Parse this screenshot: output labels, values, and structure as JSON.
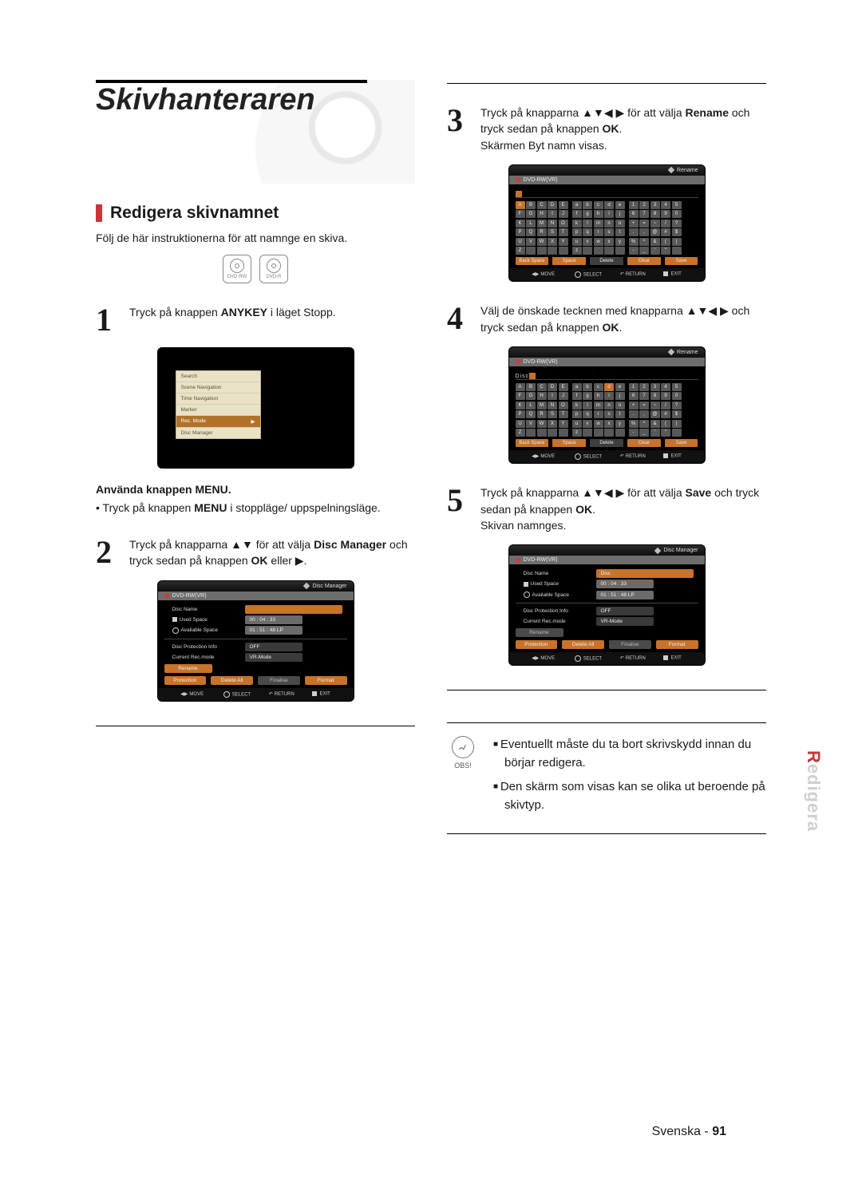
{
  "chapter_title": "Skivhanteraren",
  "section_title": "Redigera skivnamnet",
  "intro": "Följ de här instruktionerna för att namnge en skiva.",
  "badges": [
    "DVD-RW",
    "DVD-R"
  ],
  "side_tab_highlight": "R",
  "side_tab_rest": "edigera",
  "steps": {
    "s1": {
      "n": "1",
      "text_a": "Tryck på knappen ",
      "bold_a": "ANYKEY",
      "text_b": " i läget Stopp."
    },
    "s2": {
      "n": "2",
      "text_a": "Tryck på knapparna ",
      "arrows": "▲▼",
      "text_b": " för att välja ",
      "bold_a": "Disc Manager",
      "text_c": " och tryck sedan på knappen ",
      "bold_b": "OK",
      "text_d": " eller ",
      "tail": "▶."
    },
    "s3": {
      "n": "3",
      "text_a": "Tryck på knapparna ",
      "arrows": "▲▼◀ ▶",
      "text_b": " för att välja ",
      "bold_a": "Rename",
      "text_c": " och tryck sedan på knappen ",
      "bold_b": "OK",
      "text_d": ".",
      "line2": "Skärmen Byt namn visas."
    },
    "s4": {
      "n": "4",
      "text_a": "Välj de önskade tecknen med knapparna ",
      "arrows": "▲▼◀ ▶",
      "text_b": " och tryck sedan på knappen ",
      "bold_a": "OK",
      "text_c": "."
    },
    "s5": {
      "n": "5",
      "text_a": "Tryck på knapparna ",
      "arrows": "▲▼◀ ▶",
      "text_b": " för att välja ",
      "bold_a": "Save",
      "text_c": " och tryck sedan på knappen ",
      "bold_b": "OK",
      "text_d": ".",
      "line2": "Skivan namnges."
    }
  },
  "menu_sub": {
    "title": "Använda knappen MENU.",
    "bullet_a": "Tryck på knappen ",
    "bold": "MENU",
    "bullet_b": " i stoppläge/ uppspelningsläge."
  },
  "anykey": {
    "items": [
      "Search",
      "Scene Navigation",
      "Time Navigation",
      "Marker",
      "Rec. Mode",
      "Disc Manager"
    ],
    "selected": "Rec. Mode"
  },
  "osd_common": {
    "sub_label": "DVD-RW(VR)",
    "foot_move": "MOVE",
    "foot_select": "SELECT",
    "foot_return": "RETURN",
    "foot_exit": "EXIT"
  },
  "disc_manager": {
    "title": "Disc Manager",
    "rows": {
      "disc_name": {
        "label": "Disc Name",
        "value": ""
      },
      "used": {
        "label": "Used Space",
        "value": "00 : 04 : 33"
      },
      "avail": {
        "label": "Available Space",
        "value": "01 : 51 : 48 LP"
      },
      "prot": {
        "label": "Disc Protection Info",
        "value": "OFF"
      },
      "mode": {
        "label": "Current Rec.mode",
        "value": "VR-Mode"
      }
    },
    "rename_btn": "Rename",
    "btns": [
      "Protection",
      "Delete All",
      "Finalise",
      "Format"
    ]
  },
  "disc_manager_after": {
    "disc_name_value": "Disc"
  },
  "rename": {
    "title": "Rename",
    "name_before": "",
    "name_after": "Disc",
    "upper": [
      "A",
      "B",
      "C",
      "D",
      "E",
      "F",
      "G",
      "H",
      "I",
      "J",
      "K",
      "L",
      "M",
      "N",
      "O",
      "P",
      "Q",
      "R",
      "S",
      "T",
      "U",
      "V",
      "W",
      "X",
      "Y",
      "Z",
      "",
      "",
      "",
      ""
    ],
    "lower": [
      "a",
      "b",
      "c",
      "d",
      "e",
      "f",
      "g",
      "h",
      "i",
      "j",
      "k",
      "l",
      "m",
      "n",
      "o",
      "p",
      "q",
      "r",
      "s",
      "t",
      "u",
      "v",
      "w",
      "x",
      "y",
      "z",
      "",
      "",
      "",
      ""
    ],
    "nums": [
      "1",
      "2",
      "3",
      "4",
      "5",
      "6",
      "7",
      "8",
      "9",
      "0",
      "+",
      "=",
      "~",
      "/",
      "?",
      ".",
      ",",
      "@",
      "#",
      "$",
      "%",
      "^",
      "&",
      "(",
      ")",
      "-",
      "_",
      "'",
      "\"",
      ""
    ],
    "sel_before": "A",
    "sel_after": "d",
    "controls": [
      "Back Space",
      "Space",
      "Delete",
      "Clear",
      "Save"
    ]
  },
  "note": {
    "label": "OBS!",
    "items": [
      "Eventuellt måste du ta bort skrivskydd innan du börjar redigera.",
      "Den skärm som visas kan se olika ut beroende på skivtyp."
    ]
  },
  "footer": {
    "lang": "Svenska",
    "sep": " - ",
    "page": "91"
  }
}
